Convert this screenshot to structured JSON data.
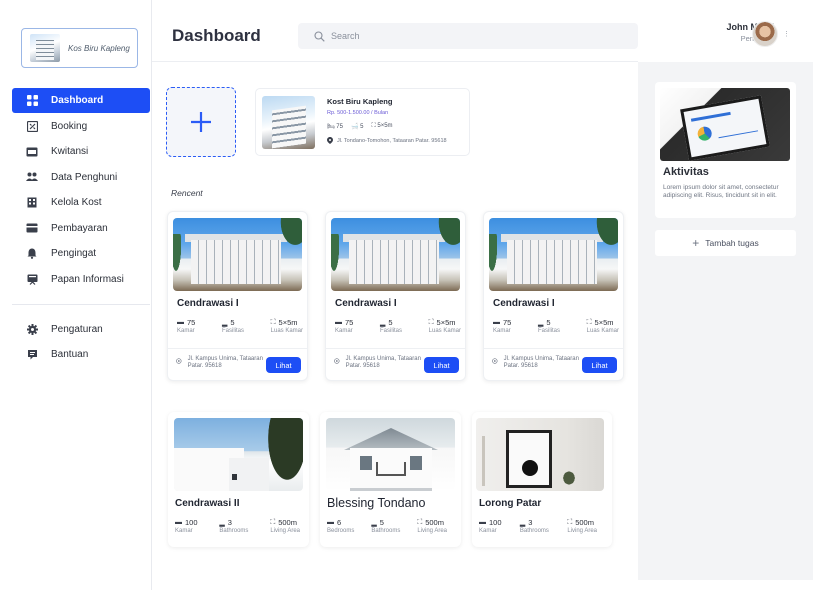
{
  "sidebar": {
    "logo_text": "Kos Biru Kapleng",
    "items": [
      {
        "label": "Dashboard",
        "icon": "grid-icon"
      },
      {
        "label": "Booking",
        "icon": "booking-icon"
      },
      {
        "label": "Kwitansi",
        "icon": "receipt-icon"
      },
      {
        "label": "Data Penghuni",
        "icon": "users-icon"
      },
      {
        "label": "Kelola Kost",
        "icon": "building-icon"
      },
      {
        "label": "Pembayaran",
        "icon": "card-icon"
      },
      {
        "label": "Pengingat",
        "icon": "bell-icon"
      },
      {
        "label": "Papan Informasi",
        "icon": "board-icon"
      }
    ],
    "bottom_items": [
      {
        "label": "Pengaturan",
        "icon": "gear-icon"
      },
      {
        "label": "Bantuan",
        "icon": "help-icon"
      }
    ]
  },
  "header": {
    "title": "Dashboard",
    "search_placeholder": "Search",
    "user_name": "John Marel",
    "user_role": "Pengelola"
  },
  "featured": {
    "title": "Kost Biru Kapleng",
    "price": "Rp. 500-1.500.00 / Bulan",
    "rooms": "75",
    "facilities": "5",
    "size": "5×5m",
    "address": "Jl. Tondano-Tomohon, Tataaran Patar. 95618"
  },
  "recent_label": "Rencent",
  "recent_cards": [
    {
      "title": "Cendrawasi I",
      "rooms": "75",
      "rooms_label": "Kamar",
      "facilities": "5",
      "facilities_label": "Fasilitas",
      "size": "5×5m",
      "size_label": "Luas Kamar",
      "address": "Jl. Kampus Unima, Tataaran Patar. 95618",
      "button": "Lihat"
    },
    {
      "title": "Cendrawasi I",
      "rooms": "75",
      "rooms_label": "Kamar",
      "facilities": "5",
      "facilities_label": "Fasilitas",
      "size": "5×5m",
      "size_label": "Luas Kamar",
      "address": "Jl. Kampus Unima, Tataaran Patar. 95618",
      "button": "Lihat"
    },
    {
      "title": "Cendrawasi I",
      "rooms": "75",
      "rooms_label": "Kamar",
      "facilities": "5",
      "facilities_label": "Fasilitas",
      "size": "5×5m",
      "size_label": "Luas Kamar",
      "address": "Jl. Kampus Unima, Tataaran Patar. 95618",
      "button": "Lihat"
    }
  ],
  "bottom_cards": [
    {
      "title": "Cendrawasi II",
      "s1": "100",
      "s1_label": "Kamar",
      "s2": "3",
      "s2_label": "Bathrooms",
      "s3": "500m",
      "s3_label": "Living Area"
    },
    {
      "title": "Blessing Tondano",
      "s1": "6",
      "s1_label": "Bedrooms",
      "s2": "5",
      "s2_label": "Bathrooms",
      "s3": "500m",
      "s3_label": "Living Area"
    },
    {
      "title": "Lorong Patar",
      "s1": "100",
      "s1_label": "Kamar",
      "s2": "3",
      "s2_label": "Bathrooms",
      "s3": "500m",
      "s3_label": "Living Area"
    }
  ],
  "activity": {
    "title": "Aktivitas",
    "description": "Lorem ipsum dolor sit amet, consectetur adipiscing elit. Risus, tincidunt sit in elit.",
    "add_task_label": "Tambah tugas"
  },
  "colors": {
    "accent": "#1d4ef5",
    "panel": "#f3f4f6"
  }
}
